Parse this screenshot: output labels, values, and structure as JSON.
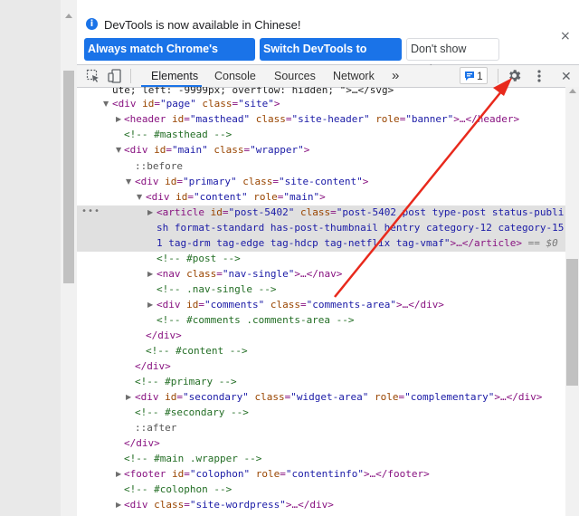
{
  "infobar": {
    "message": "DevTools is now available in Chinese!",
    "btn_match": "Always match Chrome's language",
    "btn_switch": "Switch DevTools to Chinese",
    "btn_dont_show": "Don't show again",
    "close_symbol": "×"
  },
  "toolbar": {
    "tabs": [
      "Elements",
      "Console",
      "Sources",
      "Network"
    ],
    "more_tabs": "»",
    "issues_count": "1",
    "close_symbol": "✕",
    "icons": [
      "inspect-element-icon",
      "device-toolbar-icon",
      "issues-icon",
      "gear-icon",
      "more-options-icon",
      "close-icon"
    ]
  },
  "tree": {
    "l0": "ute; left: -9999px; overflow: hidden; \">…</svg>",
    "l1_tag_open": "<div ",
    "l1_attr": "id",
    "l1_val": "\"page\"",
    "l1_attr2": "class",
    "l1_val2": "\"site\"",
    "l1_close": ">",
    "l2_tag": "<header ",
    "l2_a1": "id",
    "l2_v1": "\"masthead\"",
    "l2_a2": "class",
    "l2_v2": "\"site-header\"",
    "l2_a3": "role",
    "l2_v3": "\"banner\"",
    "l2_end": ">…</header>",
    "l3": "<!-- #masthead -->",
    "l4_tag": "<div ",
    "l4_a1": "id",
    "l4_v1": "\"main\"",
    "l4_a2": "class",
    "l4_v2": "\"wrapper\"",
    "l4_end": ">",
    "l5": "::before",
    "l6_tag": "<div ",
    "l6_a1": "id",
    "l6_v1": "\"primary\"",
    "l6_a2": "class",
    "l6_v2": "\"site-content\"",
    "l6_end": ">",
    "l7_tag": "<div ",
    "l7_a1": "id",
    "l7_v1": "\"content\"",
    "l7_a2": "role",
    "l7_v2": "\"main\"",
    "l7_end": ">",
    "l8_tag": "<article ",
    "l8_a1": "id",
    "l8_v1": "\"post-5402\"",
    "l8_a2": "class",
    "l8_v2a": "\"post-5402 post type-post status-publi",
    "l8_v2b": "sh format-standard has-post-thumbnail hentry category-12 category-15",
    "l8_v2c": "1 tag-drm tag-edge tag-hdcp tag-netflix tag-vmaf\"",
    "l8_end": ">…</article>",
    "l8_eq": " == $0",
    "l9": "<!-- #post -->",
    "l10_tag": "<nav ",
    "l10_a1": "class",
    "l10_v1": "\"nav-single\"",
    "l10_end": ">…</nav>",
    "l11": "<!-- .nav-single -->",
    "l12_tag": "<div ",
    "l12_a1": "id",
    "l12_v1": "\"comments\"",
    "l12_a2": "class",
    "l12_v2": "\"comments-area\"",
    "l12_end": ">…</div>",
    "l13": "<!-- #comments .comments-area -->",
    "l14": "</div>",
    "l15": "<!-- #content -->",
    "l16": "</div>",
    "l17": "<!-- #primary -->",
    "l18_tag": "<div ",
    "l18_a1": "id",
    "l18_v1": "\"secondary\"",
    "l18_a2": "class",
    "l18_v2": "\"widget-area\"",
    "l18_a3": "role",
    "l18_v3": "\"complementary\"",
    "l18_end": ">…</div>",
    "l19": "<!-- #secondary -->",
    "l20": "::after",
    "l21": "</div>",
    "l22": "<!-- #main .wrapper -->",
    "l23_tag": "<footer ",
    "l23_a1": "id",
    "l23_v1": "\"colophon\"",
    "l23_a2": "role",
    "l23_v2": "\"contentinfo\"",
    "l23_end": ">…</footer>",
    "l24": "<!-- #colophon -->",
    "l25_tag": "<div ",
    "l25_a1": "class",
    "l25_v1": "\"site-wordpress\"",
    "l25_end": ">…</div>",
    "selected_dots": "•••"
  },
  "colors": {
    "accent": "#1a73e8",
    "annotation_arrow": "#e8291c"
  }
}
